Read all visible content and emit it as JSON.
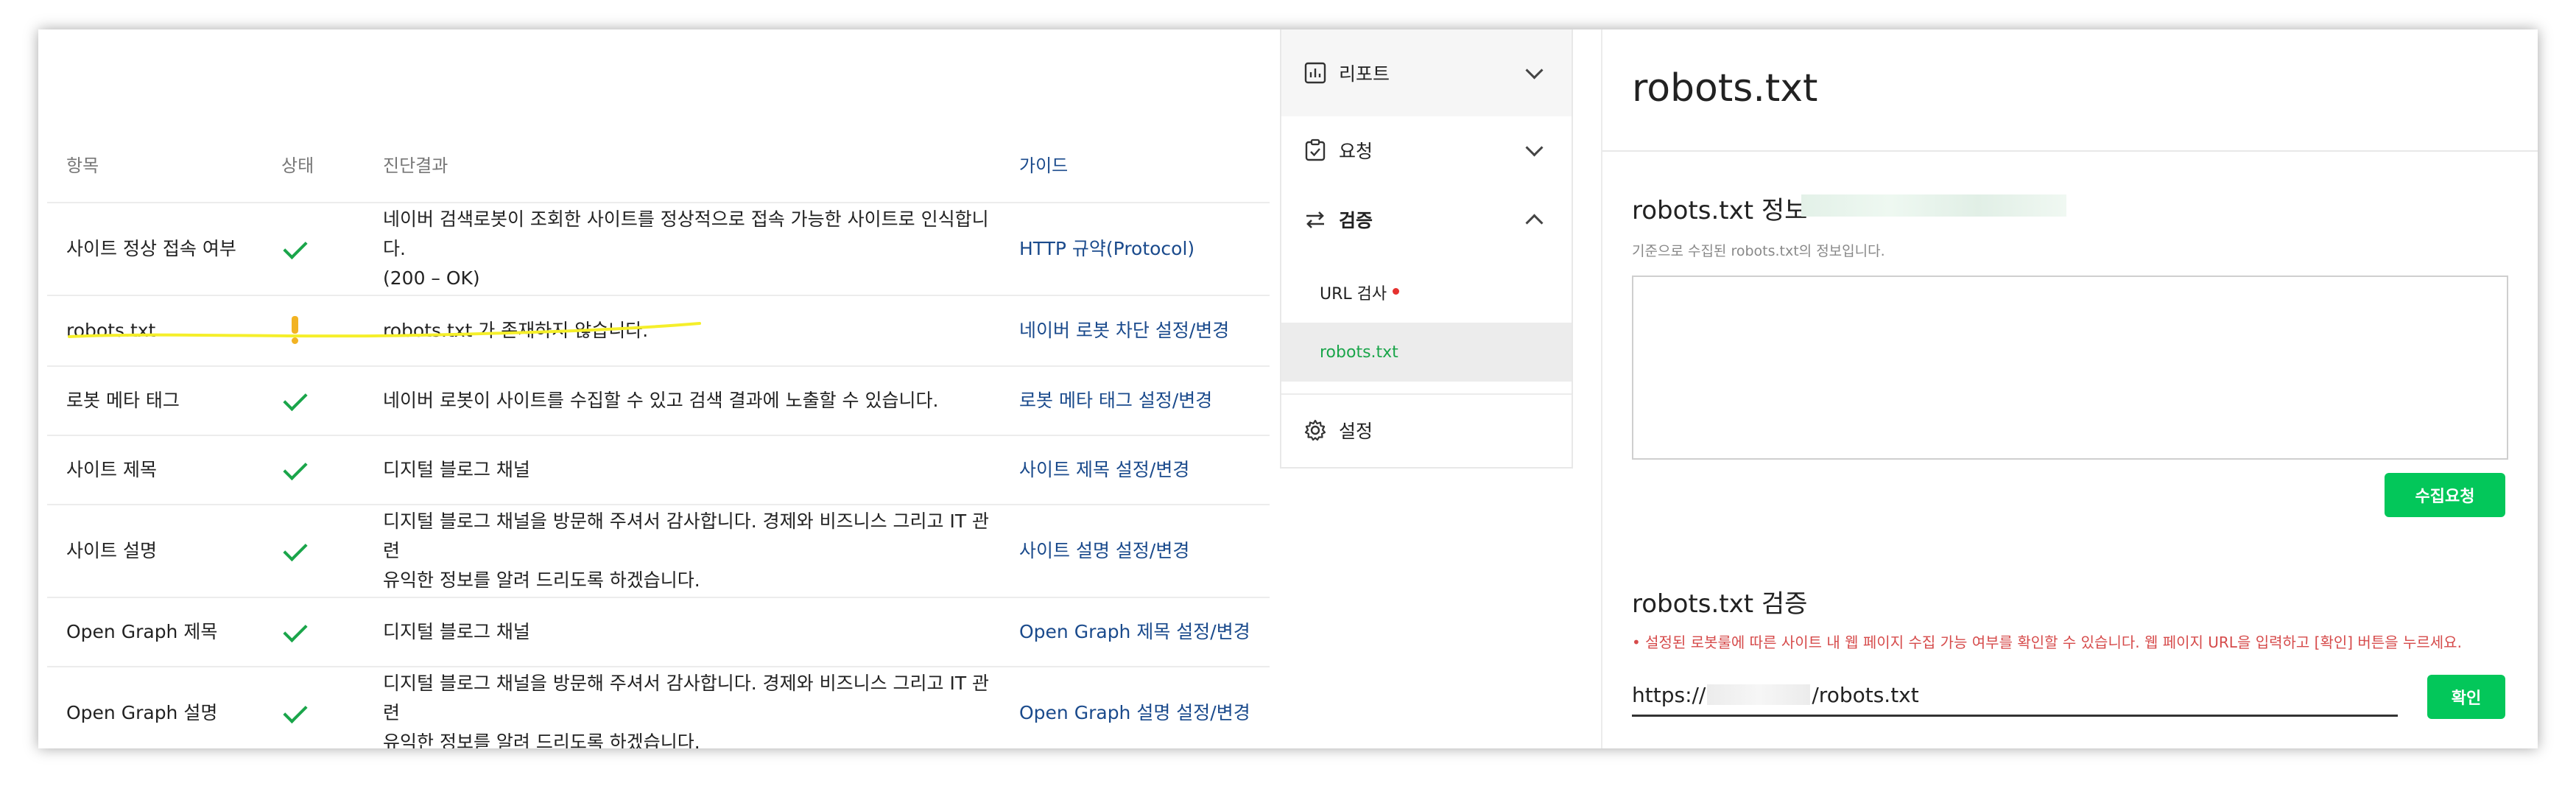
{
  "table": {
    "headers": {
      "item": "항목",
      "status": "상태",
      "result": "진단결과",
      "guide": "가이드"
    },
    "rows": [
      {
        "item": "사이트 정상 접속 여부",
        "status": "ok",
        "result": "네이버 검색로봇이 조회한 사이트를 정상적으로 접속 가능한 사이트로 인식합니다.\n(200 – OK)",
        "guide": "HTTP 규약(Protocol)"
      },
      {
        "item": "robots.txt",
        "status": "warning",
        "result": "robots.txt 가 존재하지 않습니다.",
        "guide": "네이버 로봇 차단 설정/변경"
      },
      {
        "item": "로봇 메타 태그",
        "status": "ok",
        "result": "네이버 로봇이 사이트를 수집할 수 있고 검색 결과에 노출할 수 있습니다.",
        "guide": "로봇 메타 태그 설정/변경"
      },
      {
        "item": "사이트 제목",
        "status": "ok",
        "result": "디지털 블로그 채널",
        "guide": "사이트 제목 설정/변경"
      },
      {
        "item": "사이트 설명",
        "status": "ok",
        "result": "디지털 블로그 채널을 방문해 주셔서 감사합니다. 경제와 비즈니스 그리고 IT 관련\n유익한 정보를 알려 드리도록 하겠습니다.",
        "guide": "사이트 설명 설정/변경"
      },
      {
        "item": "Open Graph 제목",
        "status": "ok",
        "result": "디지털 블로그 채널",
        "guide": "Open Graph 제목 설정/변경"
      },
      {
        "item": "Open Graph 설명",
        "status": "ok",
        "result": "디지털 블로그 채널을 방문해 주셔서 감사합니다. 경제와 비즈니스 그리고 IT 관련\n유익한 정보를 알려 드리도록 하겠습니다.",
        "guide": "Open Graph 설명 설정/변경"
      }
    ]
  },
  "nav": {
    "report": "리포트",
    "request": "요청",
    "verify": "검증",
    "sub_url_check": "URL 검사",
    "sub_robots": "robots.txt",
    "settings": "설정"
  },
  "panel": {
    "title": "robots.txt",
    "info_title": "robots.txt 정보",
    "info_desc": "기준으로 수집된 robots.txt의 정보입니다.",
    "collect_button": "수집요청",
    "verify_title": "robots.txt 검증",
    "verify_desc": "• 설정된 로봇룰에 따른 사이트 내 웹 페이지 수집 가능 여부를 확인할 수 있습니다. 웹 페이지 URL을 입력하고 [확인] 버튼을 누르세요.",
    "url_prefix": "https://",
    "url_suffix": "/robots.txt",
    "confirm_button": "확인"
  },
  "colors": {
    "ok": "#1aa54a",
    "warning": "#f2b322",
    "link": "#1a4a8c",
    "brand_green": "#03c75a",
    "active_green": "#1aa54a",
    "highlight_annotation": "#f5ef2a"
  }
}
